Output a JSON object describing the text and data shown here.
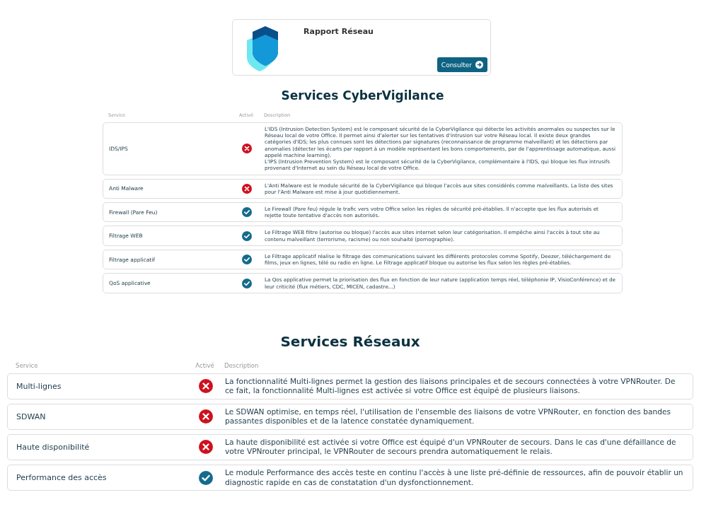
{
  "report_card": {
    "title": "Rapport Réseau",
    "button": "Consulter"
  },
  "sections": [
    {
      "kind": "compact",
      "title": "Services CyberVigilance",
      "columns": [
        "Service",
        "Activé",
        "Description"
      ],
      "rows": [
        {
          "service": "IDS/IPS",
          "active": false,
          "description": "L'IDS (Intrusion Detection System) est le composant sécurité de la CyberVigilance qui détecte les activités anormales ou suspectes sur le Réseau local de votre Office. Il permet ainsi d'alerter sur les tentatives d'intrusion sur votre Réseau local. Il existe deux grandes catégories d'IDS; les plus connues sont les détections par signatures (reconnaissance de programme malveillant) et les détections par anomalies (détecter les écarts par rapport à un modèle représentant les bons comportements, par de l'apprentissage automatique, aussi appelé machine learning).\nL'IPS (Intrusion Prevention System) est le composant sécurité de la CyberVigilance, complémentaire à l'IDS, qui bloque les flux intrusifs provenant d'Internet au sein du Réseau local de votre Office."
        },
        {
          "service": "Anti Malware",
          "active": false,
          "description": "L'Anti Malware est le module sécurité de la CyberVigilance qui bloque l'accès aux sites considérés comme malveillants. La liste des sites pour l'Anti Malware est mise à jour quotidiennement."
        },
        {
          "service": "Firewall (Pare Feu)",
          "active": true,
          "description": "Le Firewall (Pare feu) régule le trafic vers votre Office selon les règles de sécurité pré-établies. Il n'accepte que les flux autorisés et rejette toute tentative d'accès non autorisés."
        },
        {
          "service": "Filtrage WEB",
          "active": true,
          "description": "Le Filtrage WEB filtre (autorise ou bloque) l'accès aux sites internet selon leur catégorisation. Il empêche ainsi l'accès à tout site au contenu malveillant (terrorisme, racisme) ou non souhaité (pornographie)."
        },
        {
          "service": "Filtrage applicatif",
          "active": true,
          "description": "Le Filtrage applicatif réalise le filtrage des communications suivant les différents protocoles comme Spotify, Deezer, téléchargement de films, jeux en lignes, télé ou radio en ligne. Le Filtrage applicatif bloque ou autorise les flux selon les règles pré-établies."
        },
        {
          "service": "QoS applicative",
          "active": true,
          "description": "La Qos applicative permet la priorisation des flux en fonction de leur nature (application temps réel, téléphonie IP, VisioConférence) et de leur criticité (flux métiers, CDC, MICEN, cadastre...)"
        }
      ]
    },
    {
      "kind": "wide",
      "title": "Services Réseaux",
      "columns": [
        "Service",
        "Activé",
        "Description"
      ],
      "rows": [
        {
          "service": "Multi-lignes",
          "active": false,
          "description": "La fonctionnalité Multi-lignes permet la gestion des liaisons principales et de secours connectées à votre VPNRouter. De ce fait, la fonctionnalité Multi-lignes est activée si votre Office est équipé de plusieurs liaisons."
        },
        {
          "service": "SDWAN",
          "active": false,
          "description": "Le SDWAN optimise, en temps réel, l'utilisation de l'ensemble des liaisons de votre VPNRouter, en fonction des bandes passantes disponibles et de la latence constatée dynamiquement."
        },
        {
          "service": "Haute disponibilité",
          "active": false,
          "description": "La haute disponibilité est activée si votre Office est équipé d'un VPNRouter de secours. Dans le cas d'une défaillance de votre VPNrouter principal, le VPNRouter de secours prendra automatiquement le relais."
        },
        {
          "service": "Performance des accès",
          "active": true,
          "description": "Le module Performance des accès teste en continu l'accès à une liste pré-définie de ressources, afin de pouvoir établir un diagnostic rapide en cas de constatation d'un dysfonctionnement."
        }
      ]
    }
  ]
}
